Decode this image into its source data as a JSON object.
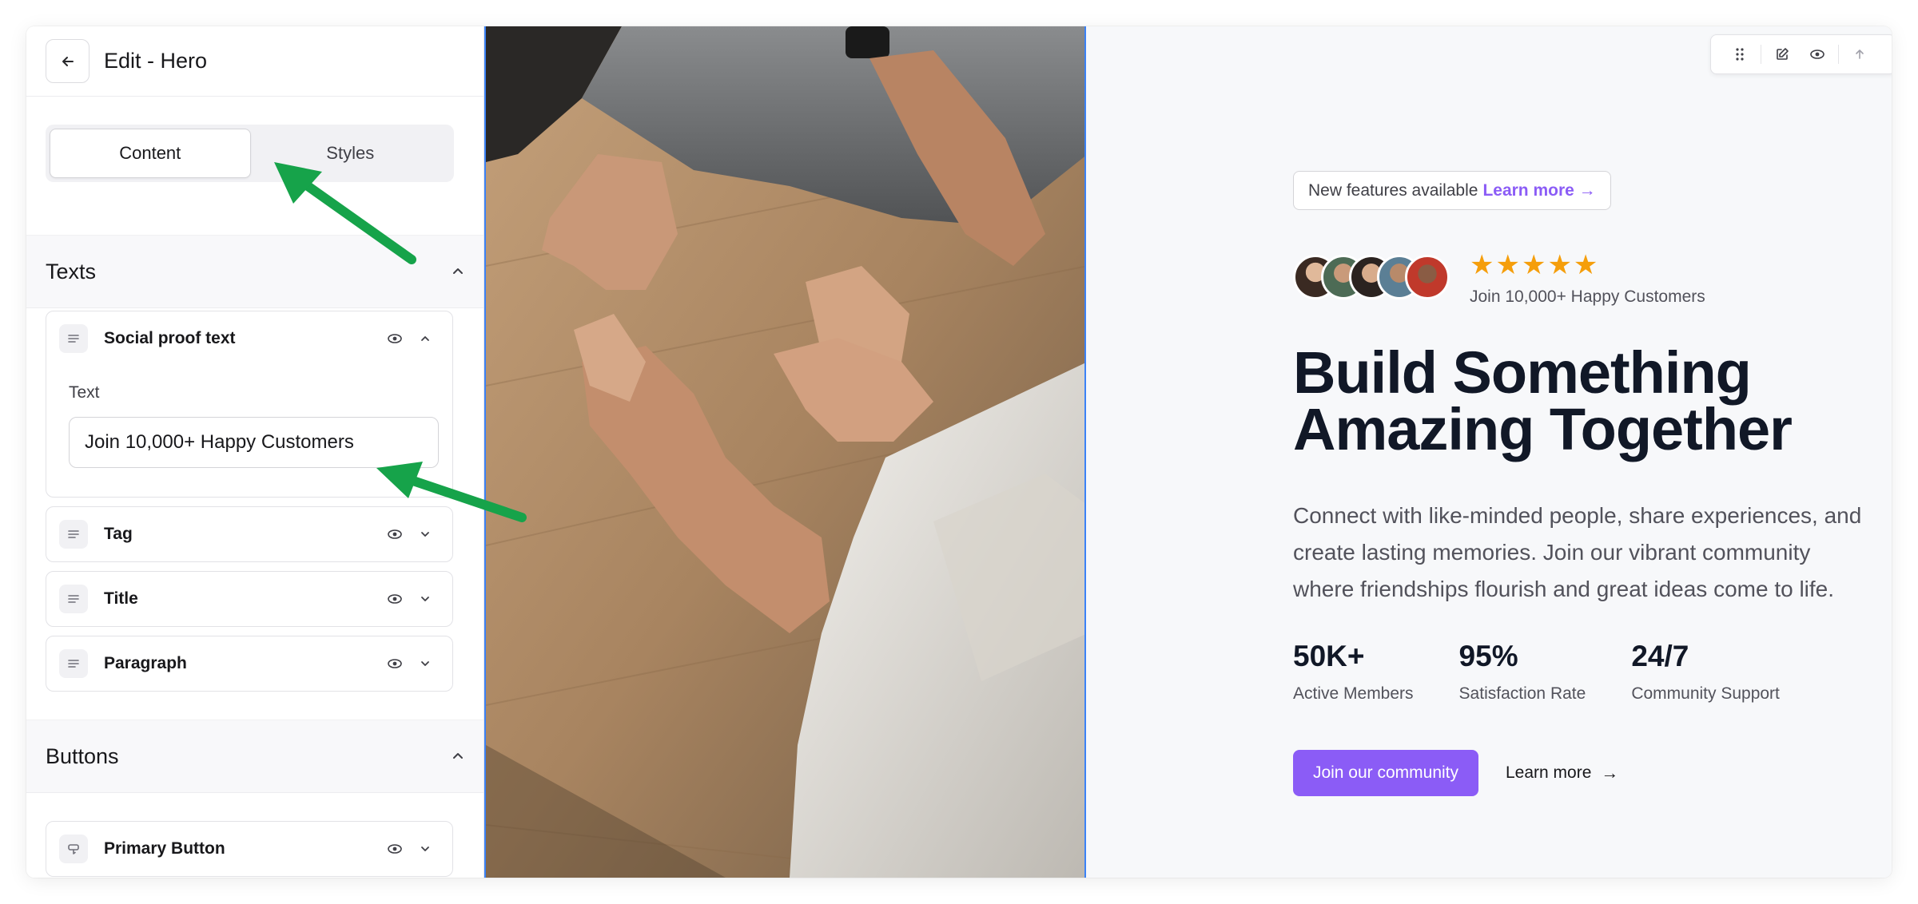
{
  "editor": {
    "title": "Edit - Hero",
    "tabs": [
      {
        "label": "Content",
        "active": true
      },
      {
        "label": "Styles",
        "active": false
      }
    ],
    "sections": {
      "texts": {
        "title": "Texts",
        "items": [
          {
            "label": "Social proof text",
            "expanded": true,
            "field_label": "Text",
            "field_value": "Join 10,000+ Happy Customers"
          },
          {
            "label": "Tag",
            "expanded": false
          },
          {
            "label": "Title",
            "expanded": false
          },
          {
            "label": "Paragraph",
            "expanded": false
          }
        ]
      },
      "buttons": {
        "title": "Buttons",
        "items": [
          {
            "label": "Primary Button",
            "expanded": false
          }
        ]
      }
    }
  },
  "toolbar": {
    "icons": [
      "drag-handle-icon",
      "edit-icon",
      "eye-icon",
      "arrow-up-icon"
    ]
  },
  "hero": {
    "tag": {
      "text": "New features available",
      "link": "Learn more →"
    },
    "rating_stars": "★★★★★",
    "social_proof": "Join 10,000+ Happy Customers",
    "title_line1": "Build Something",
    "title_line2": "Amazing Together",
    "paragraph": "Connect with like-minded people, share experiences, and create lasting memories. Join our vibrant community where friendships flourish and great ideas come to life.",
    "stats": [
      {
        "value": "50K+",
        "label": "Active Members"
      },
      {
        "value": "95%",
        "label": "Satisfaction Rate"
      },
      {
        "value": "24/7",
        "label": "Community Support"
      }
    ],
    "primary_button": "Join our community",
    "secondary_button": "Learn more",
    "secondary_arrow": "→"
  },
  "colors": {
    "accent": "#8b5cf6",
    "star": "#f59e0b",
    "selection_border": "#3b82f6",
    "annotation_arrow": "#16a34a"
  }
}
